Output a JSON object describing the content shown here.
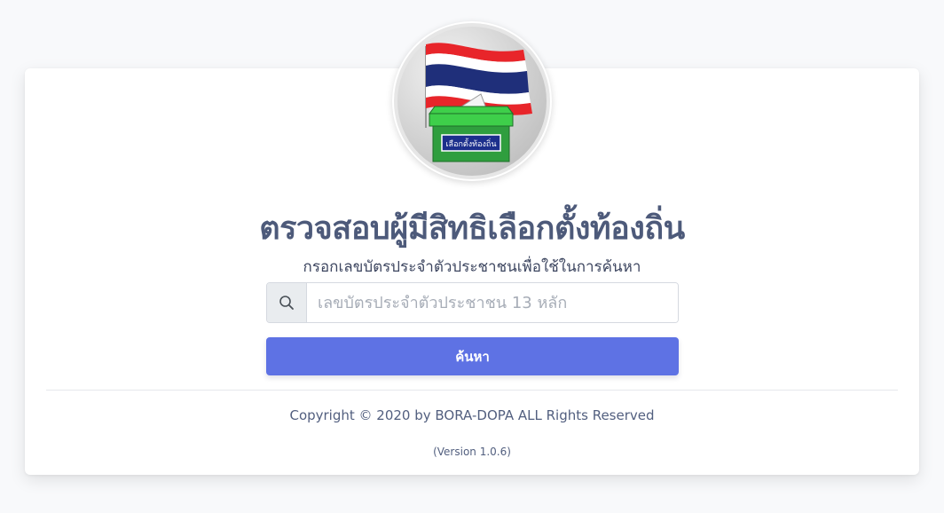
{
  "logo": {
    "box_label": "เลือกตั้งท้องถิ่น",
    "colors": {
      "flag_red": "#e8252a",
      "flag_white": "#ffffff",
      "flag_blue": "#1f2f7a",
      "box_green": "#2f9e3e",
      "box_top_green": "#3ecf4a",
      "label_blue": "#1c2f8c"
    }
  },
  "page": {
    "title": "ตรวจสอบผู้มีสิทธิเลือกตั้งท้องถิ่น",
    "subtitle": "กรอกเลขบัตรประจำตัวประชาชนเพื่อใช้ในการค้นหา"
  },
  "search": {
    "icon": "search-icon",
    "placeholder": "เลขบัตรประจำตัวประชาชน 13 หลัก",
    "value": "",
    "button_label": "ค้นหา"
  },
  "footer": {
    "copyright": "Copyright © 2020 by BORA-DOPA ALL Rights Reserved",
    "version": "(Version 1.0.6)"
  },
  "theme": {
    "accent": "#5e72e4",
    "title_color": "#4d5a7a"
  }
}
